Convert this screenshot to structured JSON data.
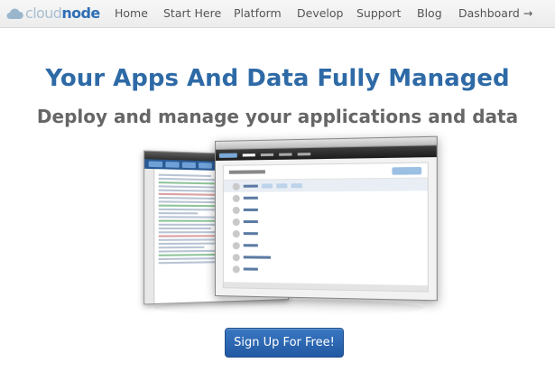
{
  "logo": {
    "part1": "cloud",
    "part2": "node",
    "icon": "cloud-icon"
  },
  "nav": {
    "items": [
      {
        "label": "Home"
      },
      {
        "label": "Start Here"
      },
      {
        "label": "Platform"
      },
      {
        "label": "Develop"
      },
      {
        "label": "Support"
      },
      {
        "label": "Blog"
      },
      {
        "label": "Dashboard →"
      }
    ]
  },
  "hero": {
    "headline": "Your Apps And Data Fully Managed",
    "subhead": "Deploy and manage your applications and data"
  },
  "cta": {
    "label": "Sign Up For Free!"
  },
  "colors": {
    "brand": "#2f6eb5",
    "headline": "#2e6aa6",
    "button": "#2a66b0"
  }
}
